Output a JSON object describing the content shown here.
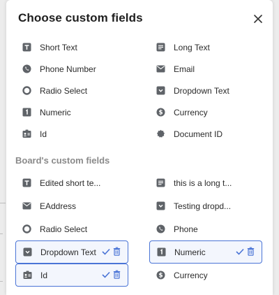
{
  "dialog": {
    "title": "Choose custom fields",
    "close_icon": "close-icon"
  },
  "field_types": [
    {
      "label": "Short Text",
      "icon": "short-text-icon"
    },
    {
      "label": "Long Text",
      "icon": "long-text-icon"
    },
    {
      "label": "Phone Number",
      "icon": "phone-icon"
    },
    {
      "label": "Email",
      "icon": "email-icon"
    },
    {
      "label": "Radio Select",
      "icon": "radio-icon"
    },
    {
      "label": "Dropdown Text",
      "icon": "dropdown-icon"
    },
    {
      "label": "Numeric",
      "icon": "numeric-icon"
    },
    {
      "label": "Currency",
      "icon": "currency-icon"
    },
    {
      "label": "Id",
      "icon": "id-card-icon"
    },
    {
      "label": "Document ID",
      "icon": "document-id-icon"
    }
  ],
  "board": {
    "section_title": "Board's custom fields",
    "fields": [
      {
        "label": "Edited short te...",
        "icon": "short-text-icon",
        "selected": false
      },
      {
        "label": "this is a long t...",
        "icon": "long-text-icon",
        "selected": false
      },
      {
        "label": "EAddress",
        "icon": "email-icon",
        "selected": false
      },
      {
        "label": "Testing dropd...",
        "icon": "dropdown-icon",
        "selected": false
      },
      {
        "label": "Radio Select",
        "icon": "radio-icon",
        "selected": false
      },
      {
        "label": "Phone",
        "icon": "phone-icon",
        "selected": false
      },
      {
        "label": "Dropdown Text",
        "icon": "dropdown-icon",
        "selected": true
      },
      {
        "label": "Numeric",
        "icon": "numeric-icon",
        "selected": true
      },
      {
        "label": "Id",
        "icon": "id-card-icon",
        "selected": true
      },
      {
        "label": "Currency",
        "icon": "currency-icon",
        "selected": false
      }
    ]
  },
  "colors": {
    "accent": "#4a74d6",
    "selected_bg": "#f3f6fd",
    "icon": "#5f6368",
    "section_title": "#8a8a8a"
  }
}
